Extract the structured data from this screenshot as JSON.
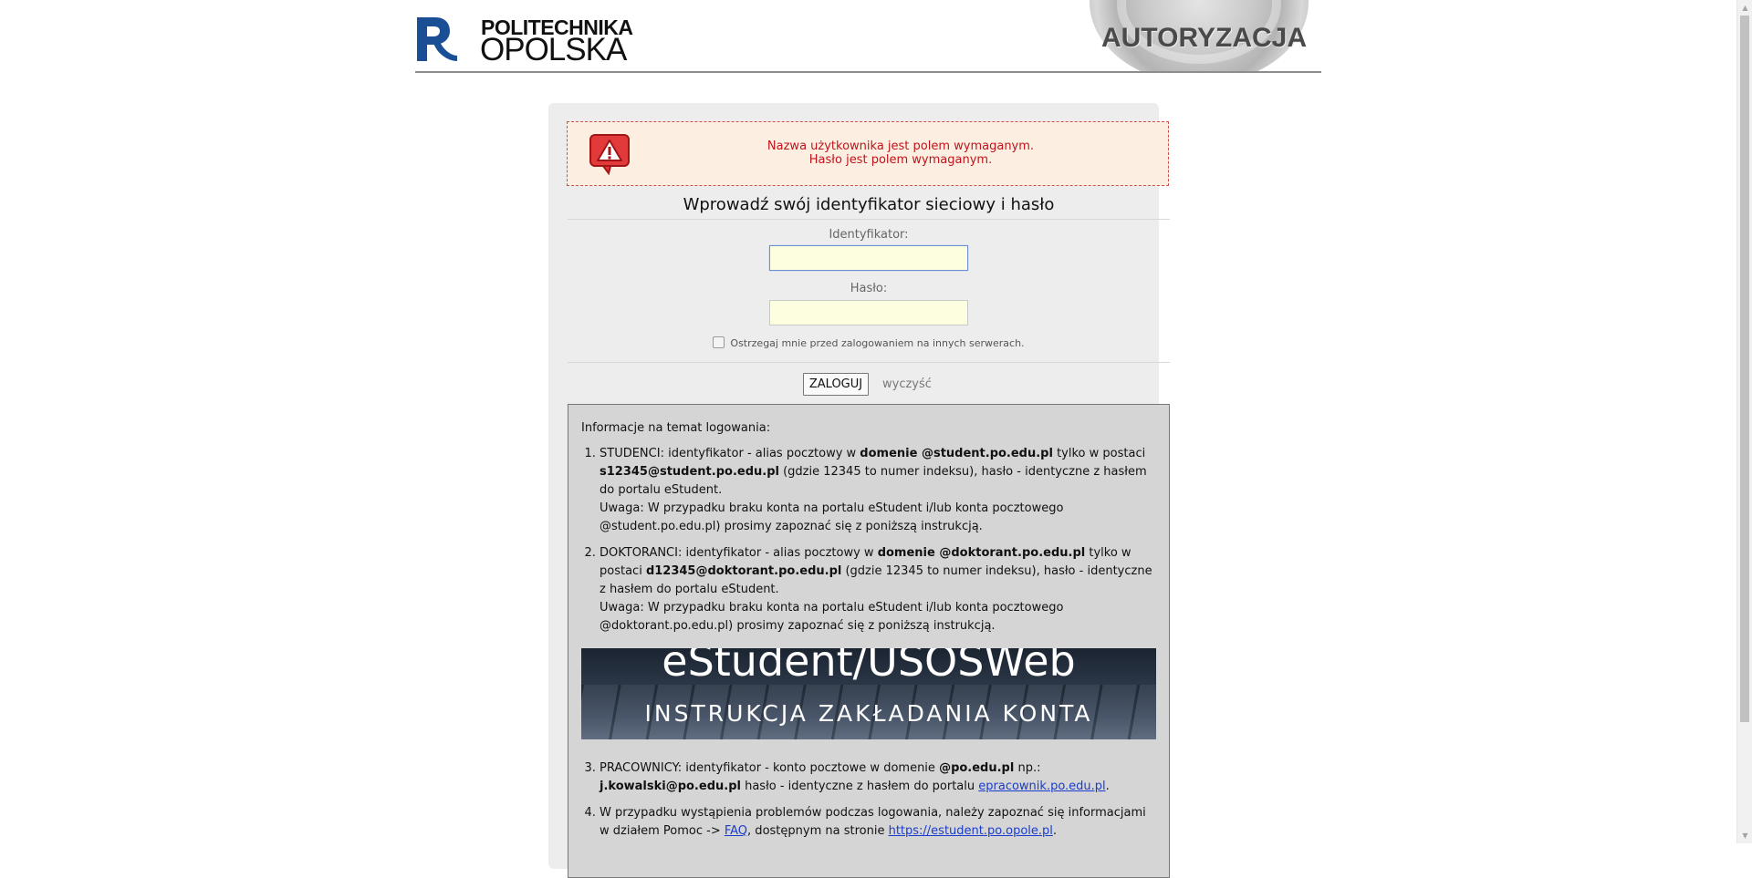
{
  "header": {
    "logo_line1": "POLITECHNIKA",
    "logo_line2": "OPOLSKA",
    "banner": "AUTORYZACJA"
  },
  "error": {
    "line1": "Nazwa użytkownika jest polem wymaganym.",
    "line2": "Hasło jest polem wymaganym."
  },
  "form": {
    "prompt": "Wprowadź swój identyfikator sieciowy i hasło",
    "id_label": "Identyfikator:",
    "id_value": "",
    "pw_label": "Hasło:",
    "pw_value": "",
    "warn_label": "Ostrzegaj mnie przed zalogowaniem na innych serwerach.",
    "warn_checked": false,
    "login_label": "ZALOGUJ",
    "clear_label": "wyczyść"
  },
  "info": {
    "title": "Informacje na temat logowania:",
    "item1": {
      "t1": "STUDENCI: identyfikator - alias pocztowy w ",
      "b1": "domenie @student.po.edu.pl",
      "t2": " tylko w postaci ",
      "b2": "s12345@student.po.edu.pl",
      "t3": " (gdzie 12345 to numer indeksu), hasło - identyczne z hasłem do portalu eStudent.",
      "note": "Uwaga: W przypadku braku konta na portalu eStudent i/lub konta pocztowego @student.po.edu.pl) prosimy zapoznać się z poniższą instrukcją."
    },
    "item2": {
      "t1": "DOKTORANCI: identyfikator - alias pocztowy w ",
      "b1": "domenie @doktorant.po.edu.pl",
      "t2": " tylko w postaci ",
      "b2": "d12345@doktorant.po.edu.pl",
      "t3": " (gdzie 12345 to numer indeksu), hasło - identyczne z hasłem do portalu eStudent.",
      "note": "Uwaga: W przypadku braku konta na portalu eStudent i/lub konta pocztowego @doktorant.po.edu.pl) prosimy zapoznać się z poniższą instrukcją."
    },
    "promo": {
      "title": "eStudent/USOSWeb",
      "subtitle": "INSTRUKCJA ZAKŁADANIA KONTA"
    },
    "item3": {
      "t1": "PRACOWNICY: identyfikator - konto pocztowe w domenie ",
      "b1": "@po.edu.pl",
      "t2": " np.: ",
      "b2": "j.kowalski@po.edu.pl",
      "t3": " hasło - identyczne z hasłem do portalu ",
      "link": "epracownik.po.edu.pl",
      "t4": "."
    },
    "item4": {
      "t1": "W przypadku wystąpienia problemów podczas logowania, należy zapoznać się informacjami w działem Pomoc -> ",
      "link1": "FAQ",
      "t2": ", dostępnym na stronie ",
      "link2": "https://estudent.po.opole.pl",
      "t3": "."
    }
  }
}
